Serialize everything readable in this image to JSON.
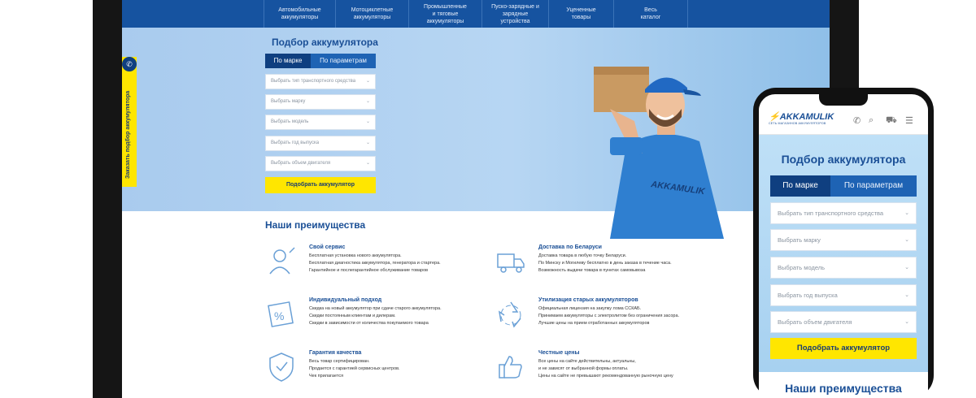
{
  "desktop": {
    "nav": [
      {
        "line1": "Автомобильные",
        "line2": "аккумуляторы"
      },
      {
        "line1": "Мотоциклетные",
        "line2": "аккумуляторы"
      },
      {
        "line1": "Промышленные",
        "line2": "и тяговые аккумуляторы"
      },
      {
        "line1": "Пуско-зарядные и",
        "line2": "зарядные устройства"
      },
      {
        "line1": "Уцененные",
        "line2": "товары"
      },
      {
        "line1": "Весь",
        "line2": "каталог"
      }
    ],
    "side_banner": "Заказать подбор аккумулятора",
    "hero_title": "Подбор аккумулятора",
    "tab_brand": "По марке",
    "tab_params": "По параметрам",
    "selects": [
      "Выбрать тип транспортного средства",
      "Выбрать марку",
      "Выбрать модель",
      "Выбрать год выпуска",
      "Выбрать объем двигателя"
    ],
    "pick_button": "Подобрать аккумулятор",
    "shirt_brand": "AKKAMULIK",
    "advantages_title": "Наши преимущества",
    "advantages": [
      {
        "title": "Свой сервис",
        "lines": [
          "Бесплатная установка нового аккумулятора.",
          "Бесплатная диагностика аккумулятора, генератора и стартера.",
          "Гарантийное и послегарантийное обслуживание товаров"
        ]
      },
      {
        "title": "Доставка по Беларуси",
        "lines": [
          "Доставка товара в любую точку Беларуси.",
          "По Минску и Могилеву бесплатно в день заказа в течение часа.",
          "Возможность выдачи товара в пунктах самовывоза"
        ]
      },
      {
        "title": "Индивидуальный подход",
        "lines": [
          "Скидка на новый аккумулятор при сдаче старого аккумулятора.",
          "Скидки постоянным клиентам и дилерам.",
          "Скидки в зависимости от количества покупаемого товара"
        ]
      },
      {
        "title": "Утилизация старых аккумуляторов",
        "lines": [
          "Официальная лицензия на закупку лома ССКАБ.",
          "Принимаем аккумуляторы с электролитом без ограничения засора.",
          "Лучшие цены на прием отработанных аккумуляторов"
        ]
      },
      {
        "title": "Гарантия качества",
        "lines": [
          "Весь товар сертифицирован.",
          "Продается с гарантией сервисных центров.",
          "Чек прилагается"
        ]
      },
      {
        "title": "Честные цены",
        "lines": [
          "Все цены на сайте действительны, актуальны,",
          "и не зависят от выбранной формы оплаты.",
          "Цены на сайте не превышают рекомендованную рыночную цену"
        ]
      }
    ]
  },
  "mobile": {
    "brand": "AKKAMULIK",
    "tagline": "СЕТЬ МАГАЗИНОВ АККУМУЛЯТОРОВ",
    "hero_title": "Подбор аккумулятора",
    "tab_brand": "По марке",
    "tab_params": "По параметрам",
    "selects": [
      "Выбрать тип транспортного средства",
      "Выбрать марку",
      "Выбрать модель",
      "Выбрать год выпуска",
      "Выбрать объем двигателя"
    ],
    "pick_button": "Подобрать аккумулятор",
    "advantages_title": "Наши преимущества"
  },
  "colors": {
    "navy": "#1653a0",
    "accent_yellow": "#ffe600",
    "title_blue": "#1a4f96"
  },
  "icons": [
    "phone-icon",
    "search-icon",
    "cart-icon",
    "menu-icon",
    "service-icon",
    "truck-icon",
    "discount-icon",
    "recycle-icon",
    "shield-icon",
    "thumbs-up-icon",
    "chevron-down-icon"
  ]
}
